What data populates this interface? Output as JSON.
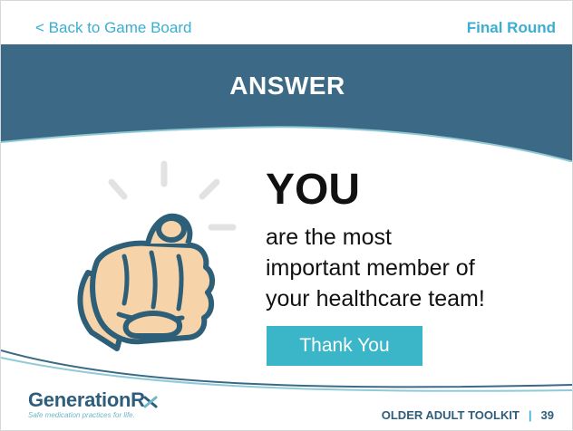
{
  "nav": {
    "back_label": "< Back to Game Board",
    "round_label": "Final Round"
  },
  "banner": {
    "title": "ANSWER"
  },
  "answer": {
    "headline": "YOU",
    "lines": [
      "are the most",
      "important member of",
      "your healthcare team!"
    ]
  },
  "button": {
    "label": "Thank You"
  },
  "footer": {
    "logo_text_main": "Generation",
    "logo_text_r": "R",
    "logo_tagline": "Safe medication practices for life.",
    "toolkit_label": "OLDER ADULT TOOLKIT",
    "separator": "|",
    "page_number": "39"
  },
  "colors": {
    "banner": "#3c6a86",
    "accent": "#3bb5c8",
    "link": "#3aaed3",
    "skin": "#f6d3a8",
    "outline": "#2d5f79"
  },
  "icons": {
    "hand": "pointing-hand-icon"
  }
}
